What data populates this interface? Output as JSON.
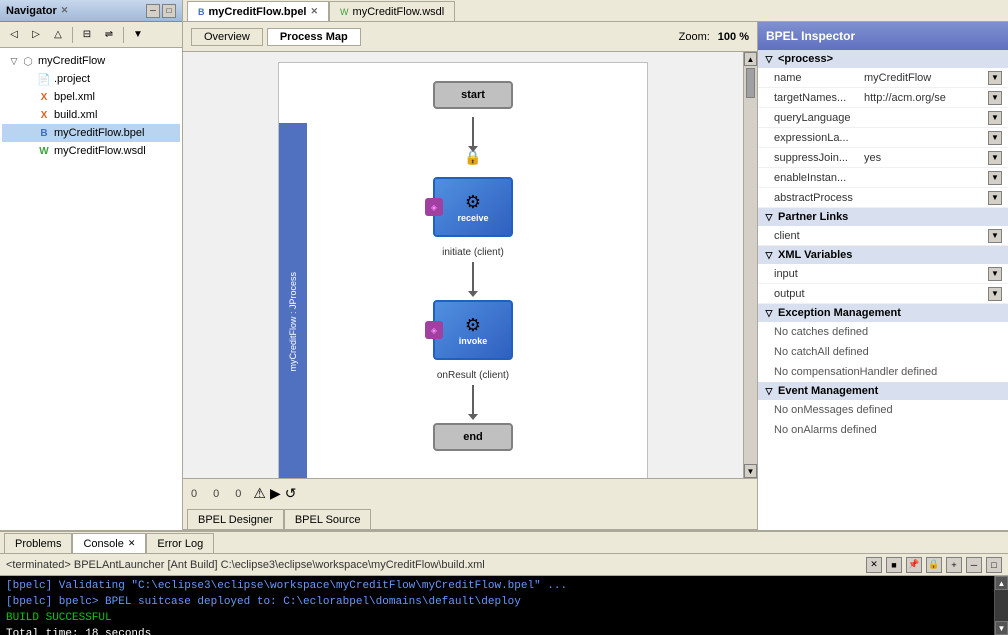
{
  "topTabs": [
    {
      "id": "myCreditFlow.bpel",
      "label": "myCreditFlow.bpel",
      "active": true,
      "closable": true,
      "icon": "bpel"
    },
    {
      "id": "myCreditFlow.wsdl",
      "label": "myCreditFlow.wsdl",
      "active": false,
      "closable": false,
      "icon": "wsdl"
    }
  ],
  "navigator": {
    "title": "Navigator",
    "tree": [
      {
        "id": "myCreditFlow",
        "label": "myCreditFlow",
        "indent": 0,
        "type": "project",
        "expanded": true
      },
      {
        "id": ".project",
        "label": ".project",
        "indent": 1,
        "type": "file"
      },
      {
        "id": "bpel.xml",
        "label": "bpel.xml",
        "indent": 1,
        "type": "xml"
      },
      {
        "id": "build.xml",
        "label": "build.xml",
        "indent": 1,
        "type": "xml"
      },
      {
        "id": "myCreditFlow.bpel",
        "label": "myCreditFlow.bpel",
        "indent": 1,
        "type": "bpel",
        "selected": true
      },
      {
        "id": "myCreditFlow.wsdl",
        "label": "myCreditFlow.wsdl",
        "indent": 1,
        "type": "wsdl"
      }
    ]
  },
  "canvas": {
    "overviewLabel": "Overview",
    "processmapLabel": "Process Map",
    "zoomLabel": "Zoom:",
    "zoomValue": "100 %",
    "processLabel": "myCreditFlow : JProcess",
    "nodes": [
      {
        "id": "start",
        "type": "start",
        "label": "start"
      },
      {
        "id": "receive",
        "type": "receive",
        "label": "receive",
        "caption": "initiate (client)",
        "hasBadge": true
      },
      {
        "id": "invoke",
        "type": "invoke",
        "label": "invoke",
        "caption": "onResult (client)",
        "hasBadge": true
      },
      {
        "id": "end",
        "type": "end",
        "label": "end"
      }
    ],
    "coordinates": [
      "0",
      "0",
      "0"
    ]
  },
  "inspector": {
    "title": "BPEL Inspector",
    "sections": [
      {
        "id": "process",
        "label": "<process>",
        "expanded": true,
        "rows": [
          {
            "key": "name",
            "value": "myCreditFlow"
          },
          {
            "key": "targetNames...",
            "value": "http://acm.org/se"
          },
          {
            "key": "queryLanguage",
            "value": ""
          },
          {
            "key": "expressionLa...",
            "value": ""
          },
          {
            "key": "suppressJoin...",
            "value": "yes"
          },
          {
            "key": "enableInstan...",
            "value": ""
          },
          {
            "key": "abstractProcess",
            "value": ""
          }
        ]
      },
      {
        "id": "partnerLinks",
        "label": "Partner Links",
        "expanded": true,
        "rows": [
          {
            "key": "client",
            "value": ""
          }
        ]
      },
      {
        "id": "xmlVariables",
        "label": "XML Variables",
        "expanded": true,
        "rows": [
          {
            "key": "input",
            "value": ""
          },
          {
            "key": "output",
            "value": ""
          }
        ]
      },
      {
        "id": "exceptionManagement",
        "label": "Exception Management",
        "expanded": true,
        "notes": [
          "No catches defined",
          "No catchAll defined",
          "No compensationHandler defined"
        ]
      },
      {
        "id": "eventManagement",
        "label": "Event Management",
        "expanded": true,
        "notes": [
          "No onMessages defined",
          "No onAlarms defined"
        ]
      }
    ]
  },
  "bottomTabs": [
    {
      "id": "bpelDesigner",
      "label": "BPEL Designer",
      "active": false
    },
    {
      "id": "bpelSource",
      "label": "BPEL Source",
      "active": false
    }
  ],
  "consoleTabs": [
    {
      "id": "problems",
      "label": "Problems",
      "active": false
    },
    {
      "id": "console",
      "label": "Console",
      "active": true,
      "closable": true
    },
    {
      "id": "errorLog",
      "label": "Error Log",
      "active": false
    }
  ],
  "console": {
    "headerText": "<terminated> BPELAntLauncher [Ant Build] C:\\eclipse3\\eclipse\\workspace\\myCreditFlow\\build.xml",
    "lines": [
      {
        "text": "     [bpelc] Validating \"C:\\eclipse3\\eclipse\\workspace\\myCreditFlow\\myCreditFlow.bpel\" ...",
        "color": "blue"
      },
      {
        "text": "     [bpelc] bpelc> BPEL suitcase deployed to: C:\\eclorabpel\\domains\\default\\deploy",
        "color": "blue"
      },
      {
        "text": "BUILD SUCCESSFUL",
        "color": "green"
      },
      {
        "text": "Total time: 18 seconds",
        "color": "white"
      }
    ]
  }
}
